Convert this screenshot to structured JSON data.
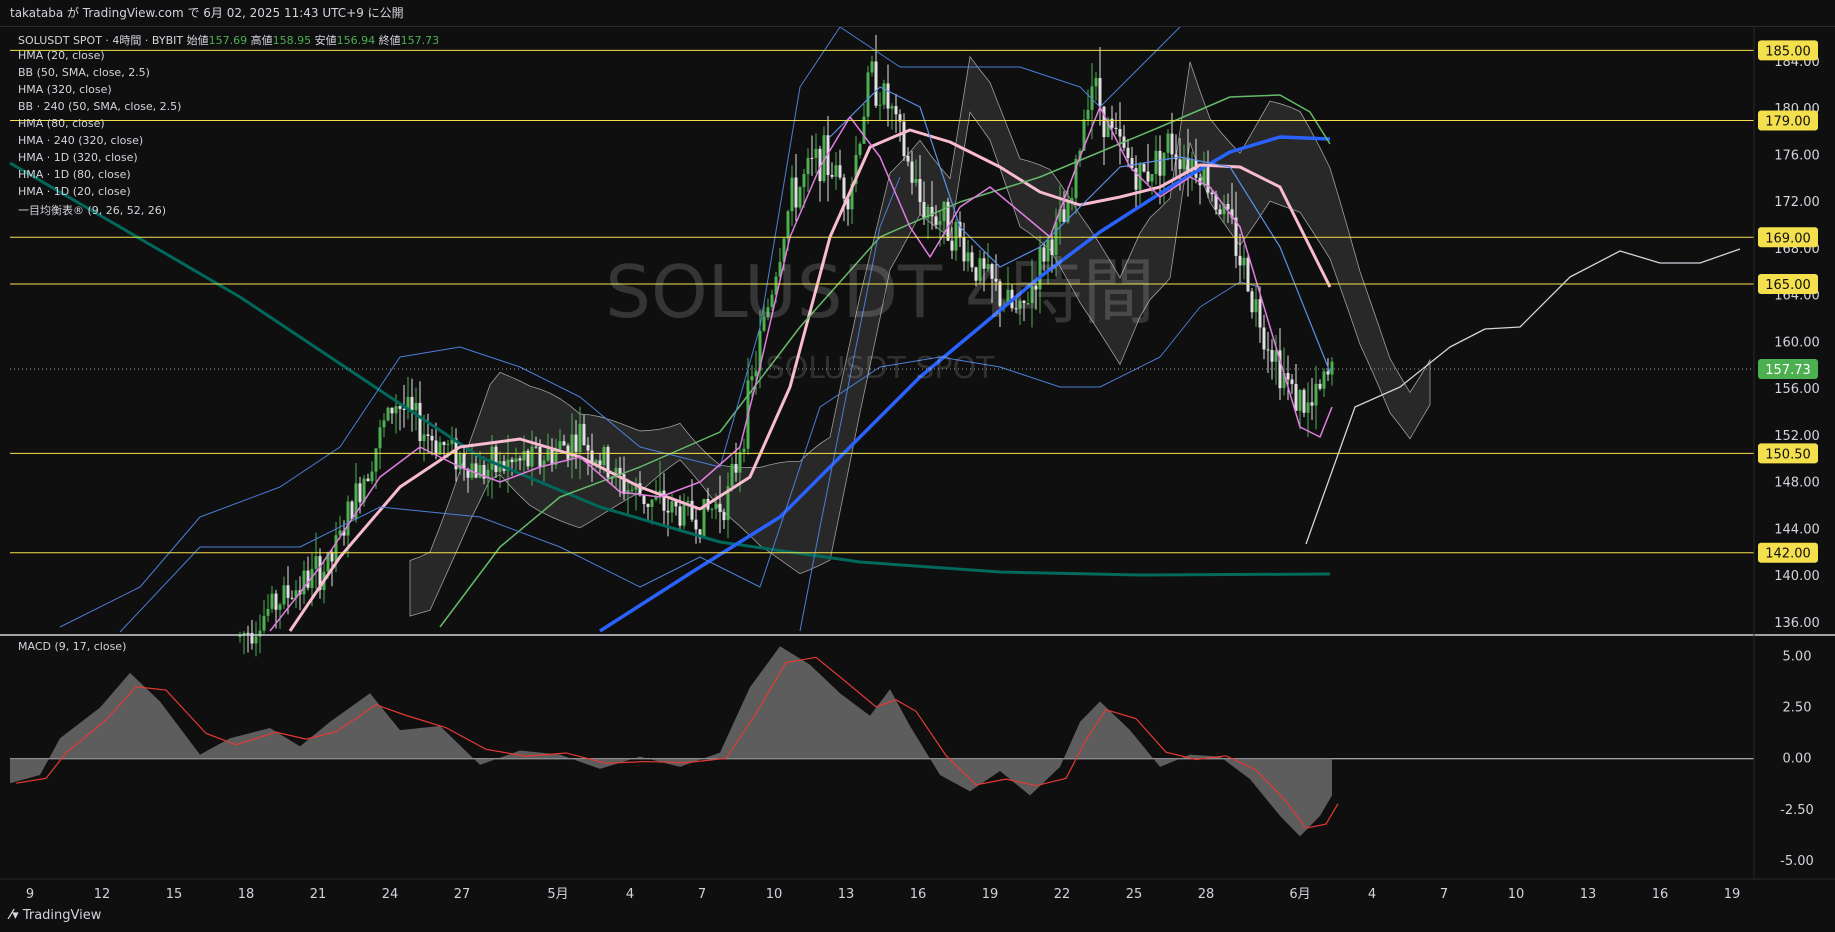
{
  "header": {
    "published_by": "takataba が TradingView.com で 6月 02, 2025 11:43 UTC+9 に公開"
  },
  "symbol_line": {
    "symbol": "SOLUSDT SPOT · 4時間 · BYBIT",
    "open_label": "始値",
    "open": "157.69",
    "high_label": "高値",
    "high": "158.95",
    "low_label": "安値",
    "low": "156.94",
    "close_label": "終値",
    "close": "157.73"
  },
  "indicators": [
    "HMA (20, close)",
    "BB (50, SMA, close, 2.5)",
    "HMA (320, close)",
    "BB · 240 (50, SMA, close, 2.5)",
    "HMA (80, close)",
    "HMA · 240 (320, close)",
    "HMA · 1D (320, close)",
    "HMA · 1D (80, close)",
    "HMA · 1D (20, close)",
    "一目均衡表® (9, 26, 52, 26)"
  ],
  "watermark": {
    "main": "SOLUSDT 4時間",
    "sub": "SOLUSDT SPOT"
  },
  "macd_label": "MACD (9, 17, close)",
  "footer": {
    "brand": "TradingView"
  },
  "colors": {
    "level_line": "#f4e04d",
    "level_tag_bg": "#f4e04d",
    "last_price_bg": "#4caf50",
    "hma20": "#e07ee0",
    "hma80_pink": "#f8bbd0",
    "hma320_blue": "#2962ff",
    "bb": "#4a7fd6",
    "green_long": "#00695c",
    "light_green": "#66bb6a",
    "candle_up": "#4caf50",
    "candle_down": "#e0e0e0",
    "macd_area": "#6b6b6b",
    "macd_signal": "#e53935"
  },
  "chart_data": {
    "type": "candlestick",
    "price_axis_ticks": [
      "184.00",
      "180.00",
      "176.00",
      "172.00",
      "168.00",
      "164.00",
      "160.00",
      "156.00",
      "152.00",
      "148.00",
      "144.00",
      "140.00",
      "136.00"
    ],
    "ylim": [
      135.3,
      187
    ],
    "time_axis_ticks": [
      "9",
      "12",
      "15",
      "18",
      "21",
      "24",
      "27",
      "5月",
      "4",
      "7",
      "10",
      "13",
      "16",
      "19",
      "22",
      "25",
      "28",
      "6月",
      "4",
      "7",
      "10",
      "13",
      "16",
      "19"
    ],
    "horizontal_levels": [
      "185.00",
      "179.00",
      "169.00",
      "165.00",
      "150.50",
      "142.00"
    ],
    "last_price": "157.73",
    "macd": {
      "ticks": [
        "5.00",
        "2.50",
        "0.00",
        "-2.50",
        "-5.00"
      ],
      "ylim": [
        -5.3,
        6.2
      ]
    }
  }
}
